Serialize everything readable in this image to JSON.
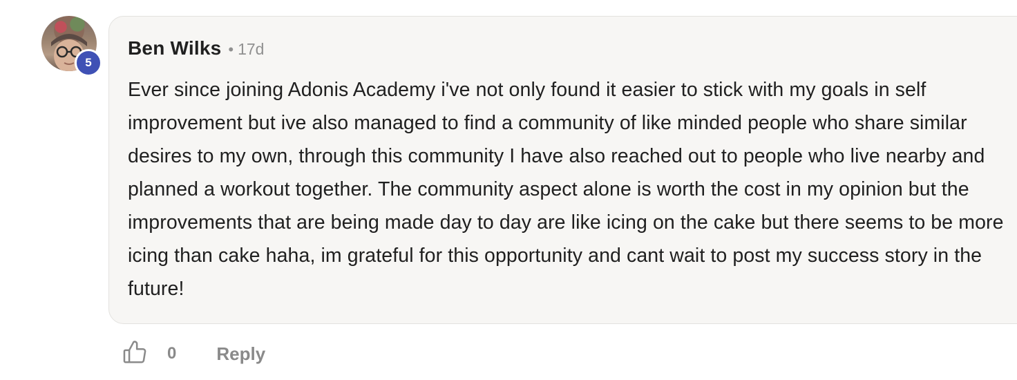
{
  "comment": {
    "author": "Ben Wilks",
    "separator": "•",
    "time_ago": "17d",
    "level": "5",
    "text": "Ever since joining Adonis Academy i've not only found it easier to stick with my goals in self improvement but ive also managed to find a community of like minded people who share similar desires to my own, through this community I have also reached out to people who live nearby and planned a workout together. The community aspect alone is worth the cost in my opinion but the improvements that are being made day to day are like icing on the cake but there seems to be more icing than cake haha, im grateful for this opportunity and cant wait to post my success story in the future!",
    "likes": "0",
    "reply_label": "Reply"
  },
  "icons": {
    "like": "thumbs-up-icon",
    "avatar": "user-avatar"
  },
  "colors": {
    "badge": "#3f51b5",
    "bubble_bg": "#f7f6f4",
    "muted_text": "#8a8a8a",
    "primary_text": "#202020"
  }
}
